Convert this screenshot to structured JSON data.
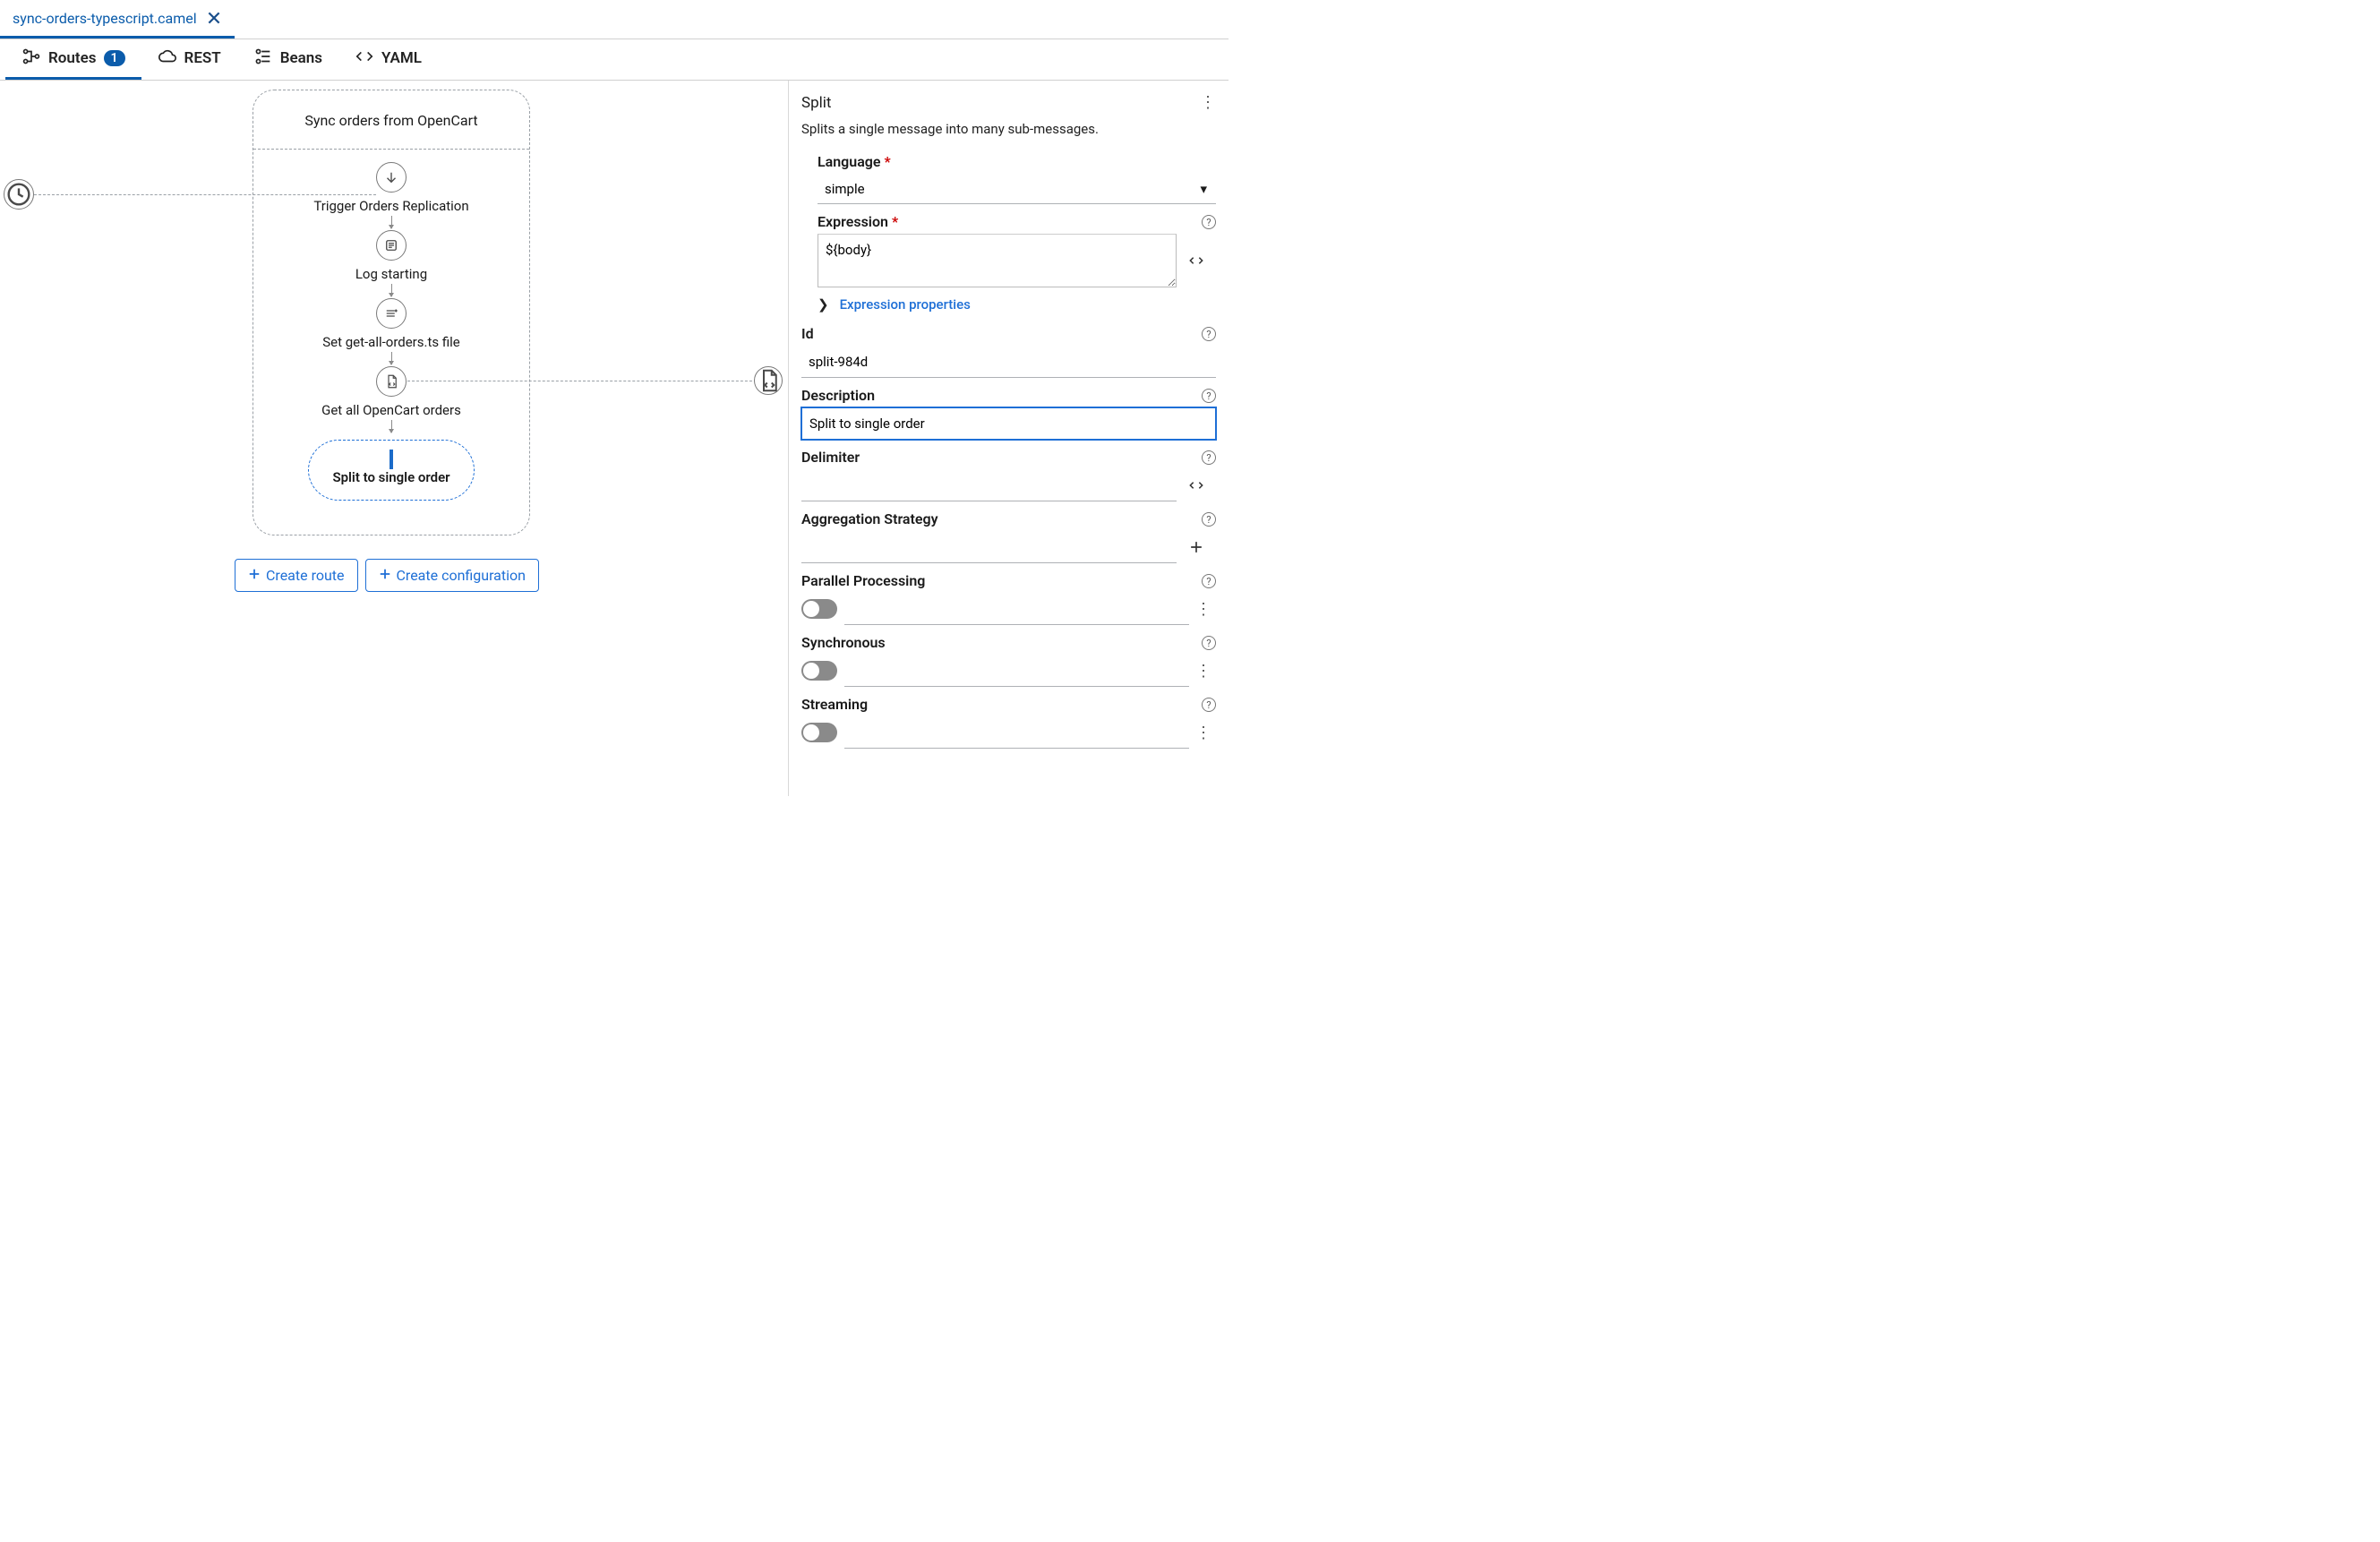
{
  "file_tab": {
    "name": "sync-orders-typescript.camel"
  },
  "view_tabs": {
    "routes": "Routes",
    "routes_count": "1",
    "rest": "REST",
    "beans": "Beans",
    "yaml": "YAML"
  },
  "route": {
    "title": "Sync orders from OpenCart",
    "nodes": [
      {
        "label": "Trigger Orders Replication"
      },
      {
        "label": "Log starting"
      },
      {
        "label": "Set get-all-orders.ts file"
      },
      {
        "label": "Get all OpenCart orders"
      },
      {
        "label": "Split to single order"
      }
    ]
  },
  "create_buttons": {
    "route": "Create route",
    "config": "Create configuration"
  },
  "panel": {
    "title": "Split",
    "description": "Splits a single message into many sub-messages.",
    "fields": {
      "language_label": "Language",
      "language_value": "simple",
      "expression_label": "Expression",
      "expression_value": "${body}",
      "expression_props_link": "Expression properties",
      "id_label": "Id",
      "id_value": "split-984d",
      "description_label": "Description",
      "description_value": "Split to single order",
      "delimiter_label": "Delimiter",
      "delimiter_value": "",
      "aggregation_label": "Aggregation Strategy",
      "aggregation_value": "",
      "parallel_label": "Parallel Processing",
      "synchronous_label": "Synchronous",
      "streaming_label": "Streaming"
    }
  }
}
